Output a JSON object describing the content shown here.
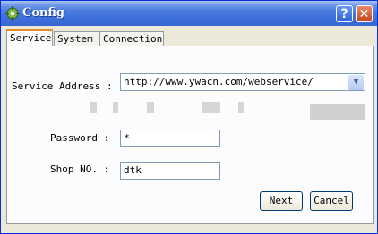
{
  "window": {
    "title": "Config",
    "help_label": "?",
    "close_label": "✕"
  },
  "tabs": [
    {
      "label": "Service"
    },
    {
      "label": "System"
    },
    {
      "label": "Connection"
    }
  ],
  "form": {
    "service_address_label": "Service Address :",
    "service_address_value": "http://www.ywacn.com/webservice/",
    "password_label": "Password :",
    "password_value": "*",
    "shop_no_label": "Shop NO. :",
    "shop_no_value": "dtk"
  },
  "buttons": {
    "next": "Next",
    "cancel": "Cancel"
  },
  "icons": {
    "app": "gear-icon",
    "dropdown": "chevron-down-icon"
  },
  "colors": {
    "titlebar": "#3c6edc",
    "tab_accent": "#e68b2c",
    "close": "#c6421e"
  }
}
